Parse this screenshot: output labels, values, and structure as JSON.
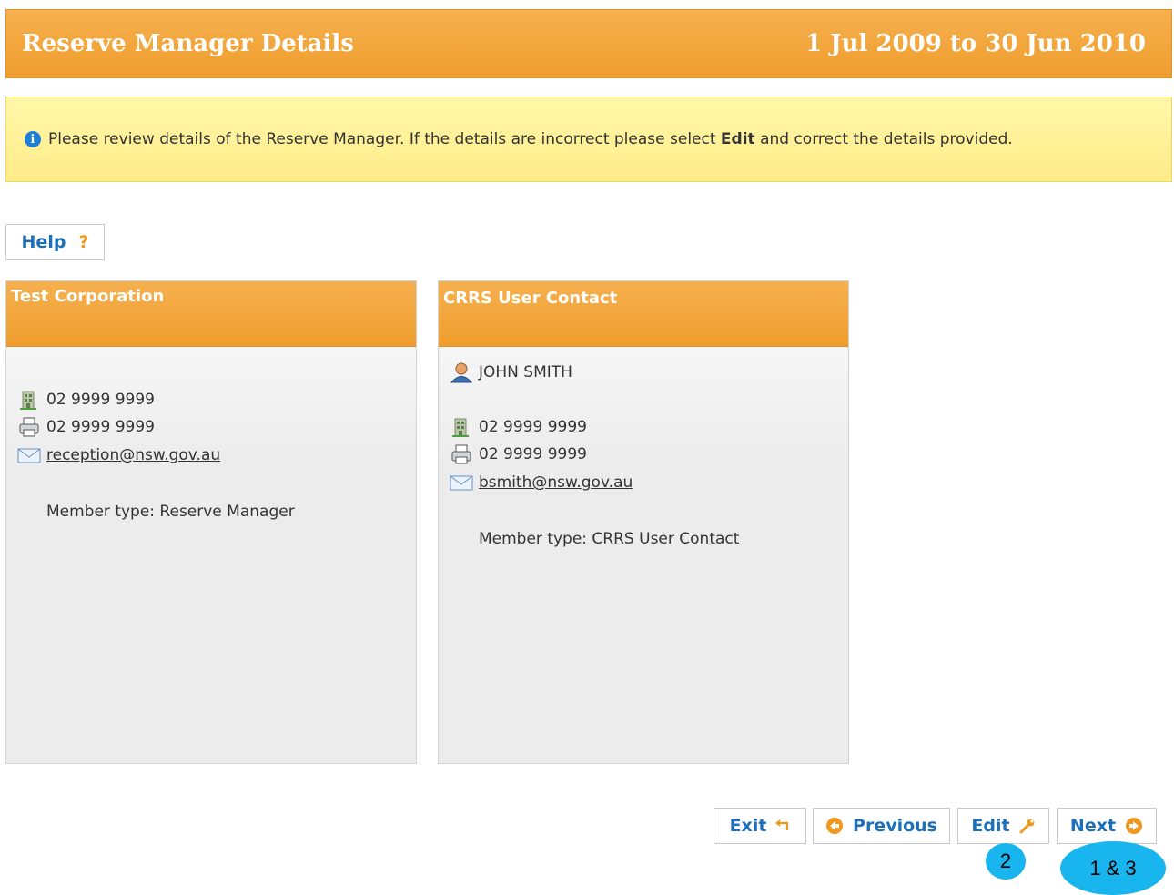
{
  "header": {
    "title": "Reserve Manager Details",
    "period": "1 Jul 2009 to 30 Jun 2010"
  },
  "info": {
    "text_before": "Please review details of the Reserve Manager. If the details are incorrect please select ",
    "bold": "Edit",
    "text_after": " and correct the details provided.",
    "icon": "info-icon"
  },
  "help": {
    "label": "Help",
    "symbol": "?"
  },
  "panels": [
    {
      "title": "Test Corporation",
      "phone": "02 9999 9999",
      "fax": "02 9999 9999",
      "email": "reception@nsw.gov.au",
      "member_type": "Member type: Reserve Manager"
    },
    {
      "title": "CRRS User Contact",
      "person": "JOHN SMITH",
      "phone": "02 9999 9999",
      "fax": "02 9999 9999",
      "email": "bsmith@nsw.gov.au",
      "member_type": "Member type: CRRS User Contact"
    }
  ],
  "buttons": {
    "exit": "Exit",
    "previous": "Previous",
    "edit": "Edit",
    "next": "Next"
  },
  "badges": {
    "edit": "2",
    "next": "1 & 3"
  },
  "colors": {
    "header_orange": "#ef9d2c",
    "info_yellow": "#fff59e",
    "link_blue": "#1c6fb8",
    "badge_blue": "#19b5ef"
  }
}
